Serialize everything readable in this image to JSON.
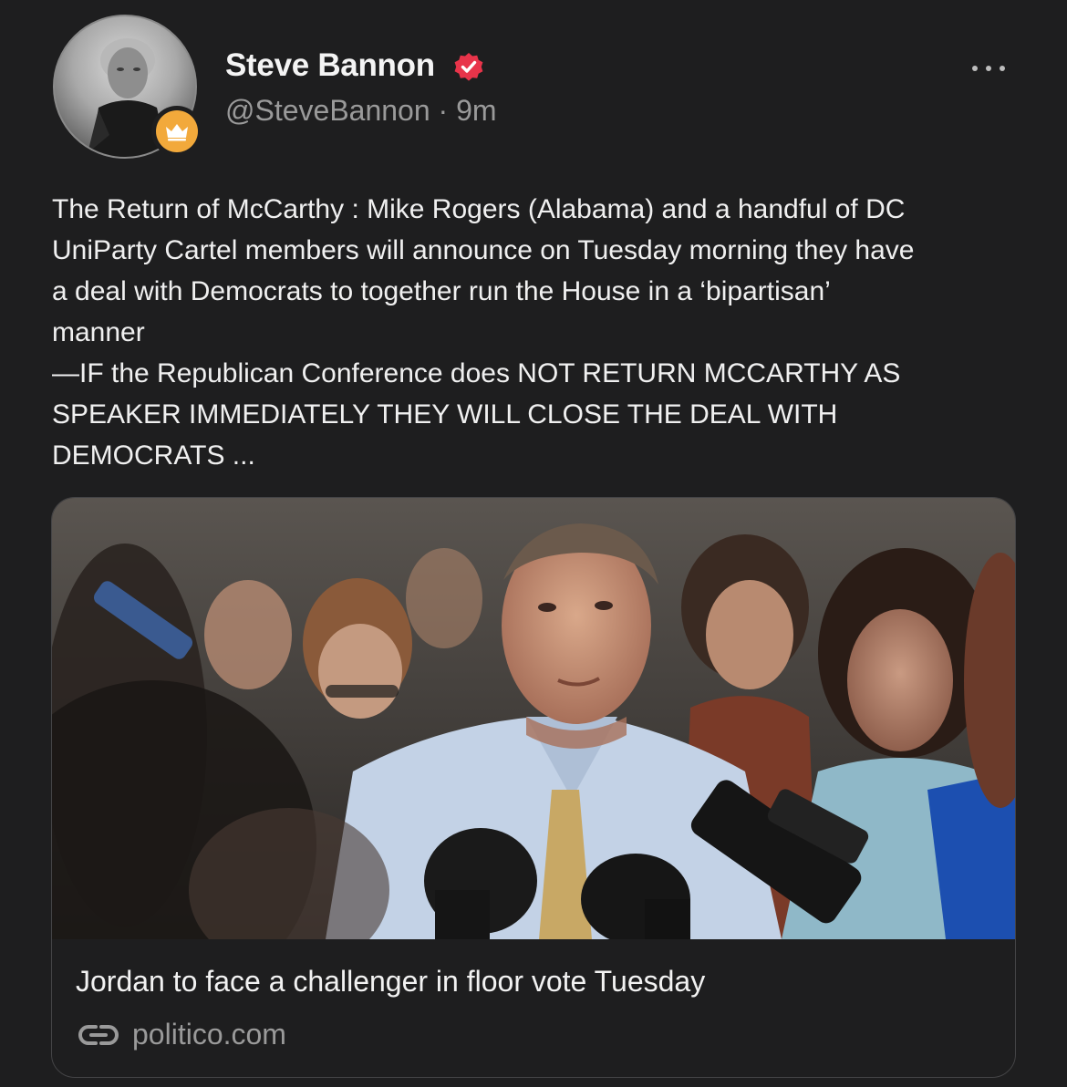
{
  "author": {
    "display_name": "Steve Bannon",
    "handle": "@SteveBannon",
    "separator": "·",
    "time": "9m",
    "verified": true,
    "badge_icon": "crown-icon"
  },
  "post": {
    "lines": [
      "The Return of McCarthy : Mike Rogers (Alabama) and a handful of DC",
      "UniParty Cartel members will announce on Tuesday morning they have",
      "a deal with Democrats to together run the House in a ‘bipartisan’",
      "manner",
      "—IF the Republican Conference does NOT RETURN MCCARTHY AS",
      "SPEAKER IMMEDIATELY THEY WILL CLOSE THE DEAL WITH",
      "DEMOCRATS ..."
    ]
  },
  "link_card": {
    "title": "Jordan to face a challenger in floor vote Tuesday",
    "domain": "politico.com",
    "domain_icon": "link-icon"
  },
  "colors": {
    "background": "#1e1e1f",
    "verified_red": "#e8344a",
    "badge_orange": "#f2a93b",
    "secondary_text": "#9a9a9a"
  }
}
